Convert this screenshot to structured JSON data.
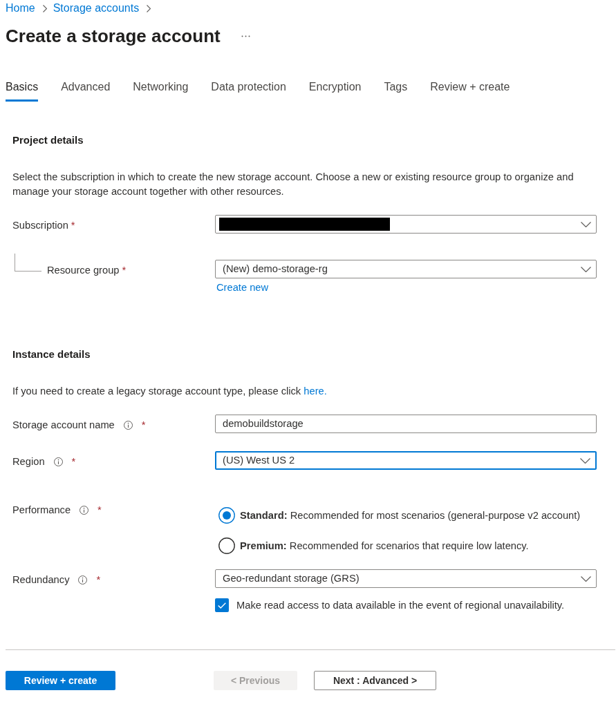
{
  "breadcrumb": [
    {
      "label": "Home"
    },
    {
      "label": "Storage accounts"
    }
  ],
  "title": "Create a storage account",
  "tabs": [
    {
      "label": "Basics",
      "selected": true
    },
    {
      "label": "Advanced",
      "selected": false
    },
    {
      "label": "Networking",
      "selected": false
    },
    {
      "label": "Data protection",
      "selected": false
    },
    {
      "label": "Encryption",
      "selected": false
    },
    {
      "label": "Tags",
      "selected": false
    },
    {
      "label": "Review + create",
      "selected": false
    }
  ],
  "sections": [
    {
      "title": "Project details",
      "description": "Select the subscription in which to create the new storage account. Choose a new or existing resource group to organize and manage your storage account together with other resources.",
      "fields": [
        {
          "kind": "dropdown",
          "label": "Subscription",
          "required_mark": "*",
          "redacted": true,
          "focused": false,
          "children": [
            {
              "kind": "dropdown",
              "label": "Resource group",
              "required_mark": "*",
              "value": "(New) demo-storage-rg",
              "focused": false,
              "link": "Create new"
            }
          ]
        }
      ]
    },
    {
      "title": "Instance details",
      "description": "If you need to create a legacy storage account type, please click",
      "description_link": "here.",
      "fields": [
        {
          "kind": "text",
          "label": "Storage account name",
          "info": true,
          "required_mark": "*",
          "value": "demobuildstorage",
          "focused": false
        },
        {
          "kind": "dropdown",
          "label": "Region",
          "info": true,
          "required_mark": "*",
          "value": "(US) West US 2",
          "focused": true
        },
        {
          "kind": "radio_group",
          "label": "Performance",
          "info": true,
          "required_mark": "*",
          "options": [
            {
              "label": "**Standard:** Recommended for most scenarios (general-purpose v2 account)",
              "selected": true
            },
            {
              "label": "**Premium:** Recommended for scenarios that require low latency.",
              "selected": false
            }
          ]
        },
        {
          "kind": "dropdown",
          "label": "Redundancy",
          "info": true,
          "required_mark": "*",
          "value": "Geo-redundant storage (GRS)",
          "focused": false,
          "checkbox": {
            "label": "Make read access to data available in the event of regional unavailability.",
            "checked": true
          }
        }
      ]
    }
  ],
  "footer_buttons": [
    {
      "label": "Review + create",
      "kind": "primary",
      "disabled": false
    },
    {
      "label": "< Previous",
      "kind": "secondary",
      "disabled": true
    },
    {
      "label": "Next : Advanced >",
      "kind": "secondary",
      "disabled": false
    }
  ]
}
